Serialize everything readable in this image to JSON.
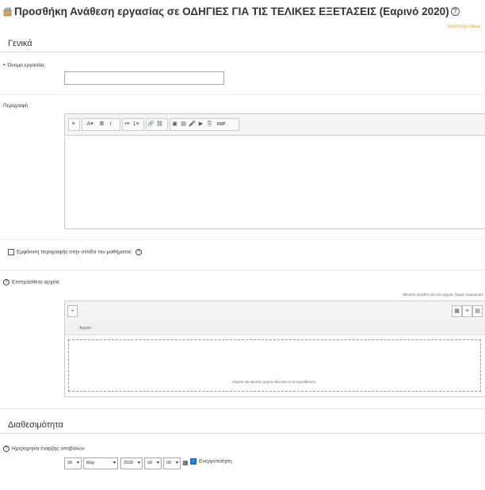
{
  "page": {
    "title": "Προσθήκη Ανάθεση εργασίας σε ΟΔΗΓΙΕΣ ΓΙΑ ΤΙΣ ΤΕΛΙΚΕΣ ΕΞΕΤΑΣΕΙΣ (Εαρινό 2020)",
    "expand_all": "Ανάπτυξη όλων"
  },
  "general": {
    "heading": "Γενικά",
    "name_label": "Όνομα εργασίας",
    "name_value": "",
    "description_label": "Περιγραφή",
    "show_description_label": "Εμφάνιση περιγραφής στην σελίδα του μαθήματος"
  },
  "editor": {
    "tools": [
      "≡",
      "A▾",
      "B",
      "I",
      "•≡",
      "1≡",
      "🔗",
      "⛓",
      "▣",
      "▤",
      "🎤",
      "▶",
      "⎘",
      "H5P"
    ]
  },
  "files": {
    "label": "Επιπρόσθετα αρχεία",
    "max_size_note": "Μέγιστο μέγεθος για νέα αρχεία: Χωρίς περιορισμό",
    "column_header": "Αρχεία",
    "drop_text": "Σύρετε και αφήστε αρχεία εδώ για να τα προσθέσετε."
  },
  "availability": {
    "heading": "Διαθεσιμότητα",
    "start_label": "Ημερομηνία έναρξης υποβολών",
    "day": "28",
    "month": "May",
    "year": "2020",
    "hour": "00",
    "minute": "00",
    "enable_label": "Ενεργοποίηση"
  },
  "colors": {
    "accent": "#e8a317",
    "checkbox": "#1e6fd9",
    "required": "#cc0000"
  }
}
